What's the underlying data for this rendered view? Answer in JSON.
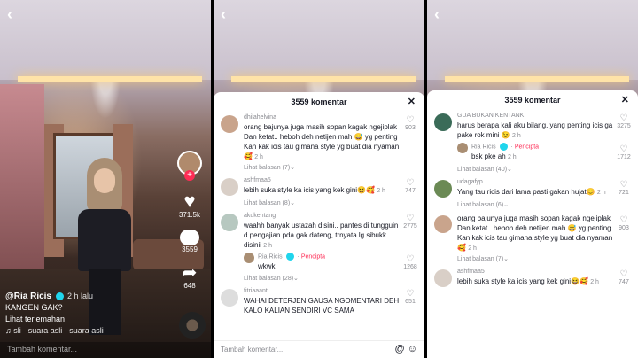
{
  "panel1": {
    "username": "@Ria Ricis",
    "time": "2 h lalu",
    "caption": "KANGEN GAK?",
    "translate": "Lihat terjemahan",
    "music": [
      "♫ sli",
      "suara asli",
      "suara asli"
    ],
    "likes": "371.5k",
    "comments": "3559",
    "shares": "648",
    "comment_placeholder": "Tambah komentar..."
  },
  "panel2": {
    "title": "3559 komentar",
    "comments": [
      {
        "user": "dhilahelvina",
        "text": "orang bajunya juga masih sopan kagak ngejiplak Dan ketat.. heboh deh netijen mah 😅 yg penting Kan kak icis tau gimana style yg buat dia nyaman 🥰",
        "time": "2 h",
        "likes": "903",
        "more": "Lihat balasan (7)⌄",
        "color": "#c9a48c"
      },
      {
        "user": "ashfmaa5",
        "text": "lebih suka style ka icis yang kek gini😆🥰",
        "time": "2 h",
        "likes": "747",
        "more": "Lihat balasan (8)⌄",
        "color": "#d9cfc7"
      },
      {
        "user": "akukentang",
        "text": "waahh banyak ustazah disini.. pantes di tungguin d pengajian pda gak dateng, trnyata lg sibukk disinii",
        "time": "2 h",
        "likes": "2775",
        "more": "",
        "color": "#b7c8c0"
      },
      {
        "user": "fitriaaanti",
        "text": "WAHAI DETERJEN GAUSA NGOMENTARI DEH KALO KALIAN SENDIRI VC SAMA",
        "time": "",
        "likes": "651",
        "more": "",
        "color": "#ddd"
      }
    ],
    "reply": {
      "user": "Ria Ricis",
      "badge": "Pencipta",
      "text": "wkwk",
      "time": "2 h",
      "likes": "1268",
      "more": "Lihat balasan (28)⌄"
    },
    "input_placeholder": "Tambah komentar..."
  },
  "panel3": {
    "title": "3559 komentar",
    "comments": [
      {
        "user": "GUA BUKAN KENTANK",
        "text": "harus berapa kali aku bilang, yang penting icis ga pake rok mini 😉",
        "time": "2 h",
        "likes": "3275",
        "more": "",
        "color": "#3a6b58"
      },
      {
        "user": "udagafyp",
        "text": "Yang tau ricis dari lama pasti gakan hujat😊",
        "time": "2 h",
        "likes": "721",
        "more": "Lihat balasan (6)⌄",
        "color": "#6b8a55"
      },
      {
        "user": "",
        "text": "orang bajunya juga masih sopan kagak ngejiplak Dan ketat.. heboh deh netijen mah 😅 yg penting Kan kak icis tau gimana style yg buat dia nyaman 🥰",
        "time": "2 h",
        "likes": "903",
        "more": "Lihat balasan (7)⌄",
        "color": "#c9a48c"
      },
      {
        "user": "ashfmaa5",
        "text": "lebih suka style ka icis yang kek gini😆🥰",
        "time": "2 h",
        "likes": "747",
        "more": "",
        "color": "#d9cfc7"
      }
    ],
    "reply": {
      "user": "Ria Ricis",
      "badge": "Pencipta",
      "text": "bsk pke ah",
      "time": "2 h",
      "likes": "1712",
      "more": "Lihat balasan (40)⌄"
    }
  }
}
